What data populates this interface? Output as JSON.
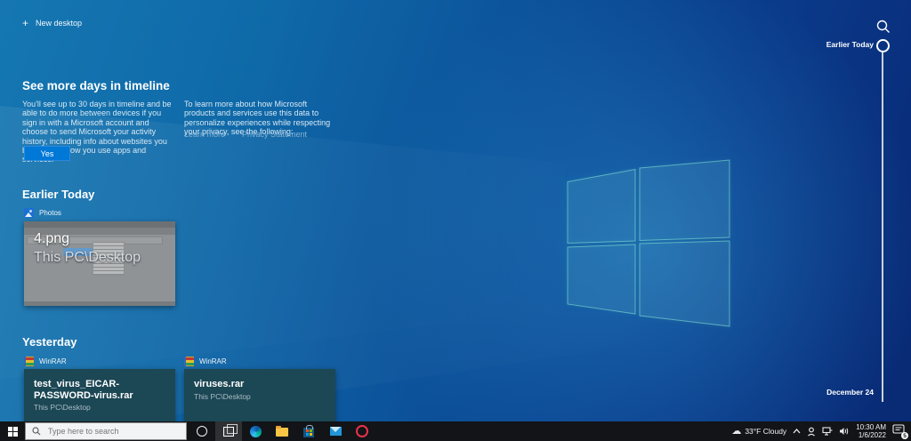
{
  "colors": {
    "accent": "#0078d7",
    "card_bg": "#1c4754",
    "taskbar_bg": "#121418"
  },
  "top": {
    "new_desktop": "New desktop"
  },
  "promo": {
    "title": "See more days in timeline",
    "body_left": "You'll see up to 30 days in timeline and be able to do more between devices if you sign in with a Microsoft account and choose to send Microsoft your activity history, including info about websites you browse and how you use apps and services.",
    "body_right": "To learn more about how Microsoft products and services use this data to personalize experiences while respecting your privacy, see the following:",
    "links": {
      "learn_more": "Learn more",
      "privacy": "Privacy Statement"
    },
    "yes_button": "Yes"
  },
  "sections": {
    "earlier_today": {
      "heading": "Earlier Today",
      "card": {
        "app": "Photos",
        "title": "4.png",
        "path": "This PC\\Desktop"
      }
    },
    "yesterday": {
      "heading": "Yesterday",
      "cards": [
        {
          "app": "WinRAR",
          "title": "test_virus_EICAR-PASSWORD-virus.rar",
          "path": "This PC\\Desktop"
        },
        {
          "app": "WinRAR",
          "title": "viruses.rar",
          "path": "This PC\\Desktop"
        }
      ]
    }
  },
  "rail": {
    "current": "Earlier Today",
    "end": "December 24"
  },
  "taskbar": {
    "search_placeholder": "Type here to search",
    "tray": {
      "weather": "33°F Cloudy",
      "time": "10:30 AM",
      "date": "1/6/2022",
      "badge": "5"
    }
  }
}
